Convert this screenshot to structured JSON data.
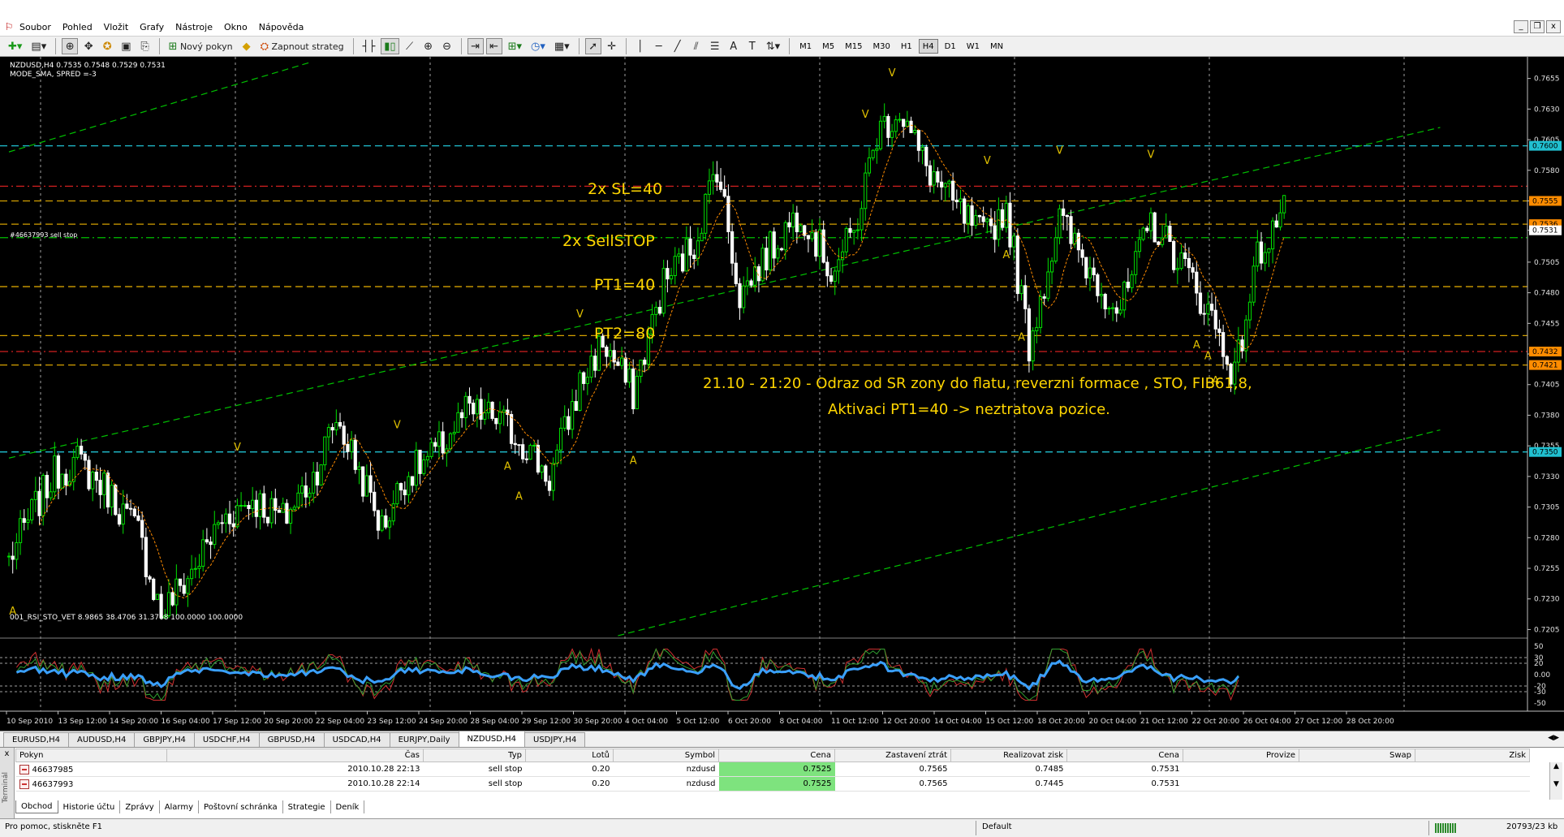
{
  "menu": {
    "items": [
      "Soubor",
      "Pohled",
      "Vložit",
      "Grafy",
      "Nástroje",
      "Okno",
      "Nápověda"
    ],
    "window_controls": [
      "_",
      "❐",
      "x"
    ]
  },
  "toolbar": {
    "new_order_label": "Nový pokyn",
    "autotrade_label": "Zapnout strateg",
    "timeframes": [
      "M1",
      "M5",
      "M15",
      "M30",
      "H1",
      "H4",
      "D1",
      "W1",
      "MN"
    ],
    "active_timeframe": "H4"
  },
  "chart": {
    "header_line1": "NZDUSD,H4  0.7535 0.7548 0.7529 0.7531",
    "header_line2": "MODE_SMA, SPRED =-3",
    "order_label": "#46637993 sell stop",
    "indicator_header": "001_RSI_STO_VET 8.9865 38.4706 31.3768 100.0000 100.0000",
    "annotations": {
      "sl": "2x SL=40",
      "sellstop": "2x SellSTOP",
      "pt1": "PT1=40",
      "pt2": "PT2=80",
      "comment_line1": "21.10 - 21:20 - Odraz od SR zony do flatu, reverzni formace , STO, FIB61,8,",
      "comment_line2": "Aktivaci PT1=40 -> neztratova pozice."
    },
    "colors": {
      "bull": "#00e000",
      "bear": "#ffffff",
      "sma": "#ff8c00",
      "channel": "#00c000",
      "sr_cyan": "#20c0d0",
      "fib_yellow": "#d4a000",
      "sl_red": "#d02020",
      "rsi": "#3aa0ff"
    }
  },
  "chart_data": {
    "type": "candlestick",
    "title": "NZDUSD,H4",
    "ylim": [
      0.7198,
      0.767
    ],
    "price_ticks": [
      "0.7655",
      "0.7630",
      "0.7605",
      "0.7580",
      "0.7555",
      "0.7531",
      "0.7505",
      "0.7480",
      "0.7455",
      "0.7430",
      "0.7405",
      "0.7380",
      "0.7355",
      "0.7330",
      "0.7305",
      "0.7280",
      "0.7255",
      "0.7230",
      "0.7205"
    ],
    "price_labels": [
      {
        "price": 0.76,
        "text": "0.7600",
        "color": "#20c0d0"
      },
      {
        "price": 0.7555,
        "text": "0.7555",
        "color": "#ff8c00"
      },
      {
        "price": 0.7536,
        "text": "0.7536",
        "color": "#ff8c00"
      },
      {
        "price": 0.7531,
        "text": "0.7531",
        "color": "#000000"
      },
      {
        "price": 0.7432,
        "text": "0.7432",
        "color": "#ff8c00"
      },
      {
        "price": 0.7421,
        "text": "0.7421",
        "color": "#ff8c00"
      },
      {
        "price": 0.735,
        "text": "0.7350",
        "color": "#20c0d0"
      }
    ],
    "horizontal_lines": [
      {
        "price": 0.76,
        "color": "#20c0d0",
        "style": "dashed"
      },
      {
        "price": 0.735,
        "color": "#20c0d0",
        "style": "dashed"
      },
      {
        "price": 0.7567,
        "color": "#d02020",
        "style": "dashdot"
      },
      {
        "price": 0.7555,
        "color": "#d4a000",
        "style": "dashed"
      },
      {
        "price": 0.7536,
        "color": "#d4a000",
        "style": "dashed"
      },
      {
        "price": 0.7525,
        "color": "#00c000",
        "style": "dashdot"
      },
      {
        "price": 0.7485,
        "color": "#d4a000",
        "style": "dashed"
      },
      {
        "price": 0.7445,
        "color": "#d4a000",
        "style": "dashed"
      },
      {
        "price": 0.7432,
        "color": "#d02020",
        "style": "dashdot"
      },
      {
        "price": 0.7421,
        "color": "#d4a000",
        "style": "dashed"
      }
    ],
    "channel_lines": [
      {
        "from": [
          0,
          0.7595
        ],
        "to": [
          79,
          0.7668
        ]
      },
      {
        "from": [
          0,
          0.7345
        ],
        "to": [
          376,
          0.7615
        ]
      },
      {
        "from": [
          160,
          0.72
        ],
        "to": [
          376,
          0.7368
        ]
      }
    ],
    "x_labels": [
      "10 Sep 2010",
      "13 Sep 12:00",
      "14 Sep 20:00",
      "16 Sep 04:00",
      "17 Sep 12:00",
      "20 Sep 20:00",
      "22 Sep 04:00",
      "23 Sep 12:00",
      "24 Sep 20:00",
      "28 Sep 04:00",
      "29 Sep 12:00",
      "30 Sep 20:00",
      "4 Oct 04:00",
      "5 Oct 12:00",
      "6 Oct 20:00",
      "8 Oct 04:00",
      "11 Oct 12:00",
      "12 Oct 20:00",
      "14 Oct 04:00",
      "15 Oct 12:00",
      "18 Oct 20:00",
      "20 Oct 04:00",
      "21 Oct 12:00",
      "22 Oct 20:00",
      "26 Oct 04:00",
      "27 Oct 12:00",
      "28 Oct 20:00"
    ],
    "fractals": [
      {
        "i": 1,
        "type": "A"
      },
      {
        "i": 60,
        "type": "V"
      },
      {
        "i": 102,
        "type": "V"
      },
      {
        "i": 131,
        "type": "A"
      },
      {
        "i": 134,
        "type": "A"
      },
      {
        "i": 164,
        "type": "A"
      },
      {
        "i": 150,
        "type": "V"
      },
      {
        "i": 225,
        "type": "V"
      },
      {
        "i": 232,
        "type": "V"
      },
      {
        "i": 257,
        "type": "V"
      },
      {
        "i": 262,
        "type": "A"
      },
      {
        "i": 266,
        "type": "A"
      },
      {
        "i": 276,
        "type": "V"
      },
      {
        "i": 300,
        "type": "V"
      },
      {
        "i": 312,
        "type": "A"
      },
      {
        "i": 315,
        "type": "A"
      },
      {
        "i": 317,
        "type": "A"
      }
    ],
    "waypoints": [
      [
        0,
        0.7262
      ],
      [
        6,
        0.73
      ],
      [
        12,
        0.7332
      ],
      [
        18,
        0.7342
      ],
      [
        26,
        0.7318
      ],
      [
        34,
        0.7284
      ],
      [
        40,
        0.7218
      ],
      [
        48,
        0.7252
      ],
      [
        56,
        0.7295
      ],
      [
        64,
        0.7312
      ],
      [
        72,
        0.7295
      ],
      [
        80,
        0.733
      ],
      [
        86,
        0.7378
      ],
      [
        92,
        0.7335
      ],
      [
        98,
        0.7288
      ],
      [
        104,
        0.733
      ],
      [
        112,
        0.7348
      ],
      [
        120,
        0.7382
      ],
      [
        128,
        0.7378
      ],
      [
        136,
        0.7355
      ],
      [
        142,
        0.7328
      ],
      [
        150,
        0.7405
      ],
      [
        156,
        0.744
      ],
      [
        164,
        0.7398
      ],
      [
        172,
        0.7488
      ],
      [
        180,
        0.752
      ],
      [
        186,
        0.7585
      ],
      [
        192,
        0.7478
      ],
      [
        200,
        0.7515
      ],
      [
        208,
        0.7548
      ],
      [
        216,
        0.7498
      ],
      [
        222,
        0.7528
      ],
      [
        228,
        0.761
      ],
      [
        234,
        0.763
      ],
      [
        240,
        0.7588
      ],
      [
        248,
        0.7552
      ],
      [
        256,
        0.7525
      ],
      [
        262,
        0.755
      ],
      [
        268,
        0.7438
      ],
      [
        276,
        0.754
      ],
      [
        284,
        0.7498
      ],
      [
        292,
        0.7465
      ],
      [
        300,
        0.7538
      ],
      [
        308,
        0.7505
      ],
      [
        316,
        0.746
      ],
      [
        322,
        0.7412
      ],
      [
        328,
        0.751
      ],
      [
        334,
        0.7545
      ]
    ],
    "indicator": {
      "name": "001_RSI_STO_VET",
      "values": [
        8.9865,
        38.4706,
        31.3768,
        100.0,
        100.0
      ],
      "ticks": [
        "50",
        "30",
        "20",
        "0.00",
        "-20",
        "-30",
        "-50"
      ],
      "levels": [
        30,
        20,
        -20,
        -30
      ]
    }
  },
  "symbol_tabs": [
    "EURUSD,H4",
    "AUDUSD,H4",
    "GBPJPY,H4",
    "USDCHF,H4",
    "GBPUSD,H4",
    "USDCAD,H4",
    "EURJPY,Daily",
    "NZDUSD,H4",
    "USDJPY,H4"
  ],
  "active_symbol_tab": "NZDUSD,H4",
  "orders": {
    "headers": [
      "Pokyn",
      "Čas",
      "Typ",
      "Lotů",
      "Symbol",
      "Cena",
      "Zastavení ztrát",
      "Realizovat zisk",
      "Cena",
      "Provize",
      "Swap",
      "Zisk"
    ],
    "rows": [
      [
        "46637985",
        "2010.10.28 22:13",
        "sell stop",
        "0.20",
        "nzdusd",
        "0.7525",
        "0.7565",
        "0.7485",
        "0.7531",
        "",
        "",
        ""
      ],
      [
        "46637993",
        "2010.10.28 22:14",
        "sell stop",
        "0.20",
        "nzdusd",
        "0.7525",
        "0.7565",
        "0.7445",
        "0.7531",
        "",
        "",
        ""
      ]
    ]
  },
  "terminal": {
    "side_label": "Terminál",
    "close": "x",
    "tabs": [
      "Obchod",
      "Historie účtu",
      "Zprávy",
      "Alarmy",
      "Poštovní schránka",
      "Strategie",
      "Deník"
    ],
    "active_tab": "Obchod"
  },
  "status": {
    "help": "Pro pomoc, stiskněte F1",
    "profile": "Default",
    "traffic": "20793/23 kb"
  }
}
